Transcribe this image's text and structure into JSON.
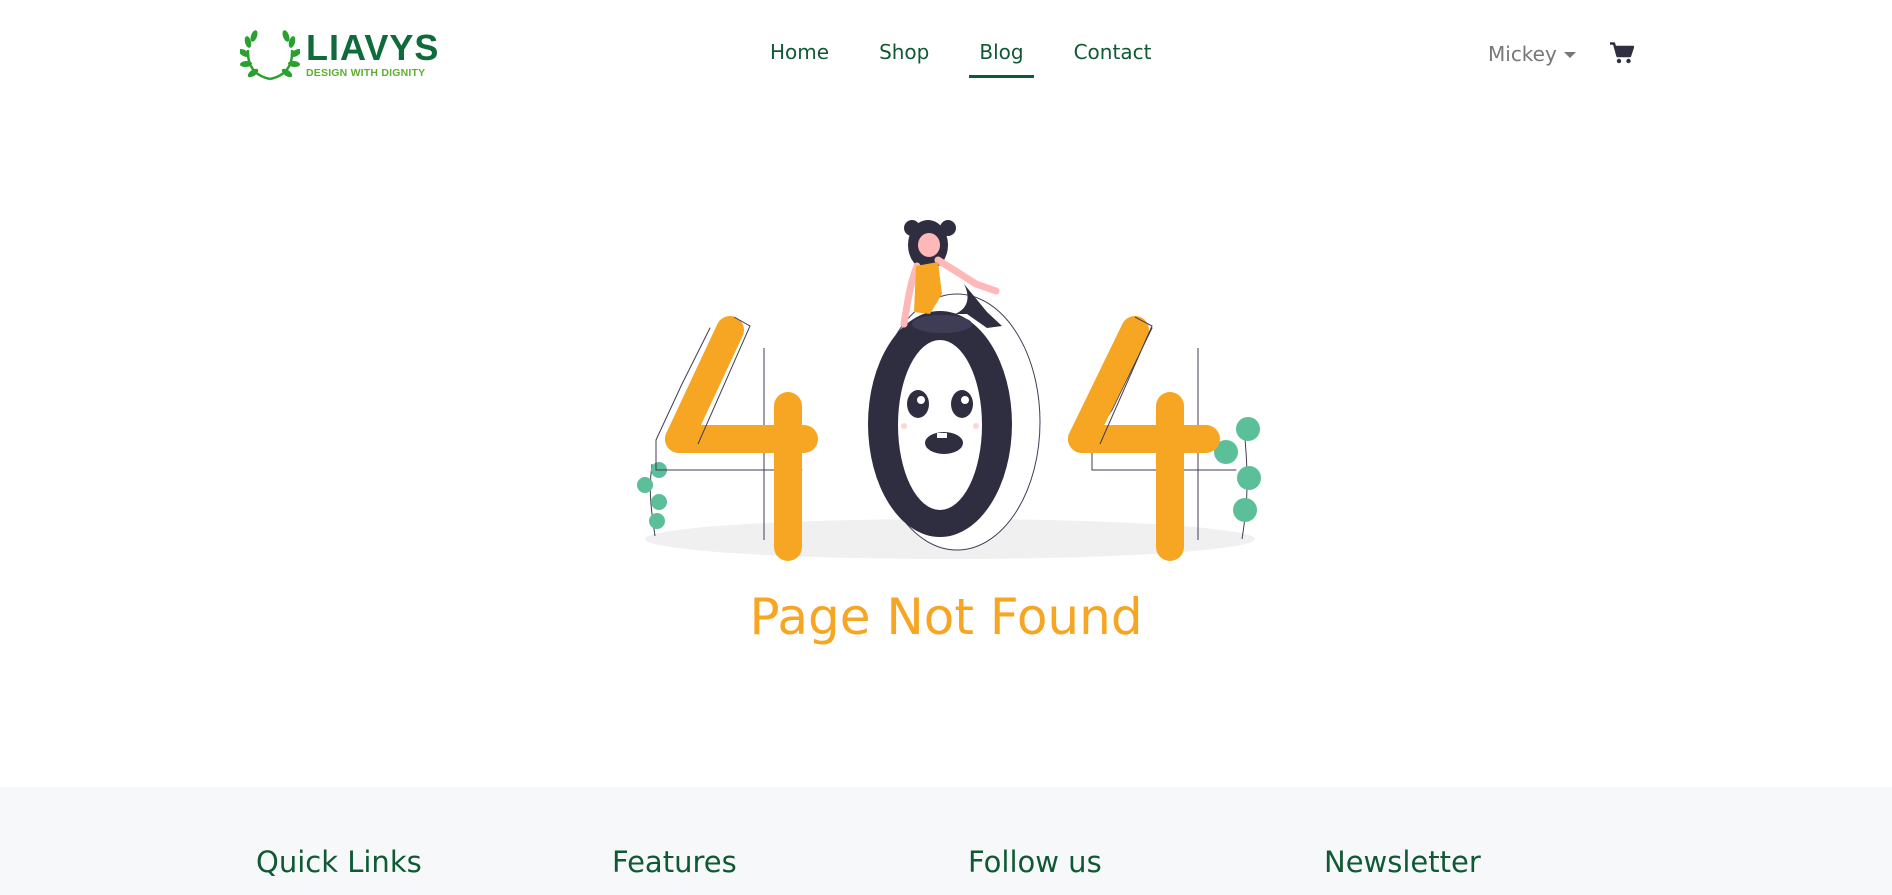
{
  "header": {
    "logo": {
      "name": "LIAVYS",
      "tagline": "DESIGN WITH DIGNITY",
      "icon": "laurel-wreath-icon"
    },
    "nav": [
      {
        "label": "Home",
        "active": false
      },
      {
        "label": "Shop",
        "active": false
      },
      {
        "label": "Blog",
        "active": true
      },
      {
        "label": "Contact",
        "active": false
      }
    ],
    "user": {
      "name": "Mickey",
      "icon": "caret-down-icon"
    },
    "cart_icon": "shopping-cart-icon"
  },
  "main": {
    "illustration": {
      "digits": [
        "4",
        "0",
        "4"
      ],
      "icon": "404-illustration"
    },
    "title": "Page Not Found"
  },
  "footer": {
    "headings": [
      "Quick Links",
      "Features",
      "Follow us",
      "Newsletter"
    ]
  },
  "colors": {
    "brand_green": "#0f6b3a",
    "nav_green": "#0f5a34",
    "accent_orange": "#f6a623",
    "dark_figure": "#2f2e41",
    "leaf_green": "#5bbf9a",
    "footer_bg": "#f7f8f9"
  }
}
